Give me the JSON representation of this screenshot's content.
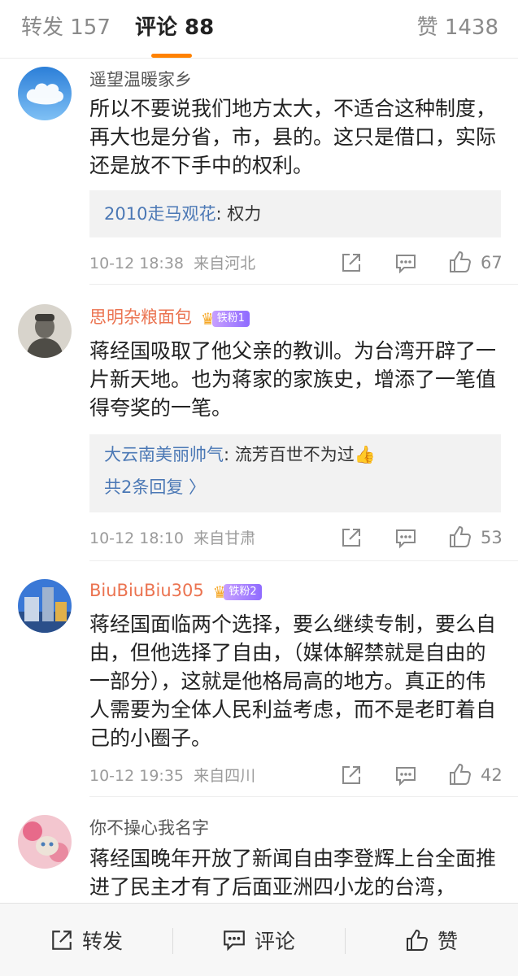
{
  "tabs": {
    "repost": "转发 157",
    "comment": "评论 88",
    "like": "赞 1438"
  },
  "comments": [
    {
      "username": "遥望温暖家乡",
      "text": "所以不要说我们地方太大，不适合这种制度，再大也是分省，市，县的。这只是借口，实际还是放不下手中的权利。",
      "reply_user": "2010走马观花",
      "reply_text": ": 权力",
      "time": "10-12 18:38",
      "location": "来自河北",
      "likes": "67"
    },
    {
      "username": "思明杂粮面包",
      "fan_badge": "铁粉1",
      "text": "蒋经国吸取了他父亲的教训。为台湾开辟了一片新天地。也为蒋家的家族史，增添了一笔值得夸奖的一笔。",
      "reply_user": "大云南美丽帅气",
      "reply_text": ": 流芳百世不为过👍",
      "reply_more": "共2条回复 〉",
      "time": "10-12 18:10",
      "location": "来自甘肃",
      "likes": "53"
    },
    {
      "username": "BiuBiuBiu305",
      "fan_badge": "铁粉2",
      "text": "蒋经国面临两个选择，要么继续专制，要么自由，但他选择了自由，（媒体解禁就是自由的一部分），这就是他格局高的地方。真正的伟人需要为全体人民利益考虑，而不是老盯着自己的小圈子。",
      "time": "10-12 19:35",
      "location": "来自四川",
      "likes": "42"
    },
    {
      "username": "你不操心我名字",
      "text": "蒋经国晚年开放了新闻自由李登辉上台全面推进了民主才有了后面亚洲四小龙的台湾，"
    }
  ],
  "bottom_bar": {
    "repost": "转发",
    "comment": "评论",
    "like": "赞"
  },
  "colors": {
    "accent": "#ff8200",
    "link": "#4b78b5",
    "username_vip": "#eb7350"
  }
}
